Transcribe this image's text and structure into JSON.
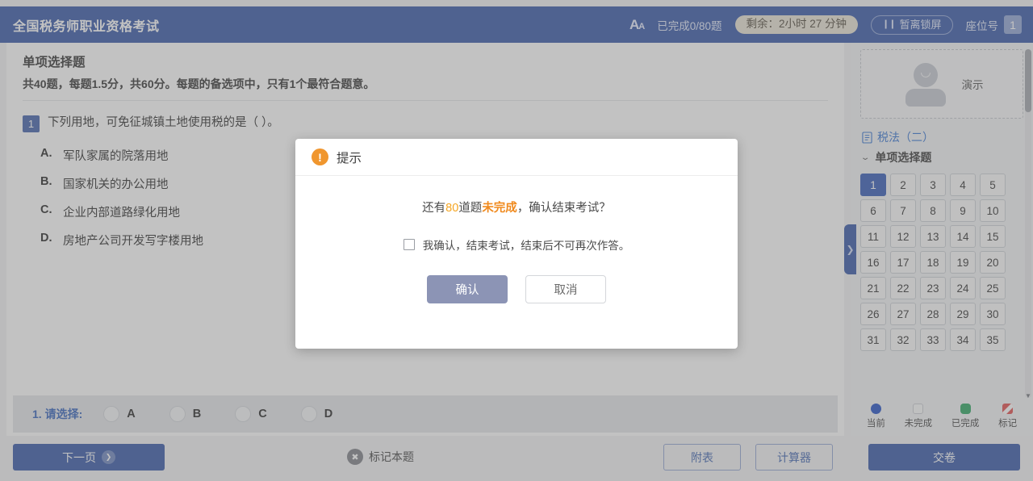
{
  "header": {
    "title": "全国税务师职业资格考试",
    "font_size_icon": "font-size-icon",
    "progress": "已完成0/80题",
    "timer": "剩余：2小时 27 分钟",
    "lock_label": "暂离锁屏",
    "seat_label": "座位号",
    "seat_number": "1",
    "bg_color": "#2e51a5"
  },
  "content": {
    "section_title": "单项选择题",
    "section_desc": "共40题，每题1.5分，共60分。每题的备选项中，只有1个最符合题意。",
    "question": {
      "number": "1",
      "text": "下列用地，可免征城镇土地使用税的是（        ）。",
      "options": [
        {
          "key": "A.",
          "text": "军队家属的院落用地"
        },
        {
          "key": "B.",
          "text": "国家机关的办公用地"
        },
        {
          "key": "C.",
          "text": "企业内部道路绿化用地"
        },
        {
          "key": "D.",
          "text": "房地产公司开发写字楼用地"
        }
      ]
    }
  },
  "answer_bar": {
    "label": "1. 请选择:",
    "choices": [
      "A",
      "B",
      "C",
      "D"
    ],
    "selected": null
  },
  "sidebar": {
    "user_name": "演示",
    "subject": "税法（二）",
    "group": "单项选择题",
    "current_question": 1,
    "questions": [
      "1",
      "2",
      "3",
      "4",
      "5",
      "6",
      "7",
      "8",
      "9",
      "10",
      "11",
      "12",
      "13",
      "14",
      "15",
      "16",
      "17",
      "18",
      "19",
      "20",
      "21",
      "22",
      "23",
      "24",
      "25",
      "26",
      "27",
      "28",
      "29",
      "30",
      "31",
      "32",
      "33",
      "34",
      "35"
    ],
    "legend": [
      {
        "label": "当前",
        "color": "#1b49c4"
      },
      {
        "label": "未完成",
        "color": "#fafbfc"
      },
      {
        "label": "已完成",
        "color": "#26a35c"
      },
      {
        "label": "标记",
        "color": "#e04646"
      }
    ]
  },
  "footer": {
    "next_label": "下一页",
    "mark_label": "标记本题",
    "appendix_label": "附表",
    "calculator_label": "计算器",
    "submit_label": "交卷"
  },
  "modal": {
    "title": "提示",
    "message_pre": "还有",
    "message_num": "80",
    "message_mid": "道题",
    "message_warn": "未完成",
    "message_post": "，确认结束考试？",
    "checkbox_label": "我确认，结束考试，结束后不可再次作答。",
    "checkbox_checked": false,
    "confirm_label": "确认",
    "cancel_label": "取消",
    "accent_color": "#f0962e"
  }
}
